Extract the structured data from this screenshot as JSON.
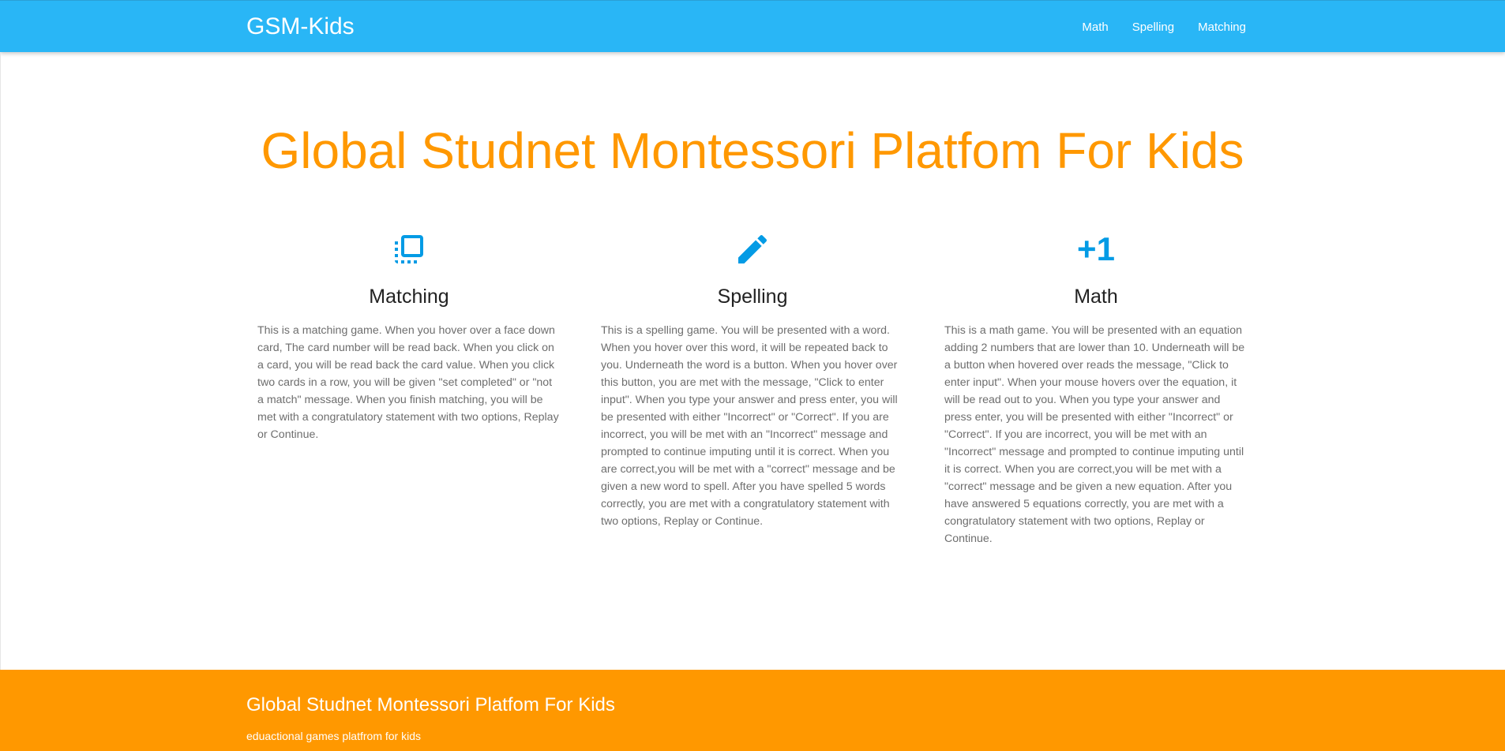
{
  "navbar": {
    "brand": "GSM-Kids",
    "links": [
      "Math",
      "Spelling",
      "Matching"
    ],
    "background_color": "#29b6f6"
  },
  "hero": {
    "title": "Global Studnet Montessori Platfom For Kids",
    "color": "#ff9800"
  },
  "features": [
    {
      "icon": "flip-to-front-icon",
      "title": "Matching",
      "text": "This is a matching game. When you hover over a face down card, The card number will be read back. When you click on a card, you will be read back the card value. When you click two cards in a row, you will be given \"set completed\" or \"not a match\" message. When you finish matching, you will be met with a congratulatory statement with two options, Replay or Continue."
    },
    {
      "icon": "pencil-icon",
      "title": "Spelling",
      "text": "This is a spelling game. You will be presented with a word. When you hover over this word, it will be repeated back to you. Underneath the word is a button. When you hover over this button, you are met with the message, \"Click to enter input\". When you type your answer and press enter, you will be presented with either \"Incorrect\" or \"Correct\". If you are incorrect, you will be met with an \"Incorrect\" message and prompted to continue imputing until it is correct. When you are correct,you will be met with a \"correct\" message and be given a new word to spell. After you have spelled 5 words correctly, you are met with a congratulatory statement with two options, Replay or Continue."
    },
    {
      "icon": "plus-one-icon",
      "icon_text": "+1",
      "title": "Math",
      "text": "This is a math game. You will be presented with an equation adding 2 numbers that are lower than 10. Underneath will be a button when hovered over reads the message, \"Click to enter input\". When your mouse hovers over the equation, it will be read out to you. When you type your answer and press enter, you will be presented with either \"Incorrect\" or \"Correct\". If you are incorrect, you will be met with an \"Incorrect\" message and prompted to continue imputing until it is correct. When you are correct,you will be met with a \"correct\" message and be given a new equation. After you have answered 5 equations correctly, you are met with a congratulatory statement with two options, Replay or Continue."
    }
  ],
  "footer": {
    "title": "Global Studnet Montessori Platfom For Kids",
    "subtitle": "eduactional games platfrom for kids",
    "background_color": "#ff9800"
  }
}
